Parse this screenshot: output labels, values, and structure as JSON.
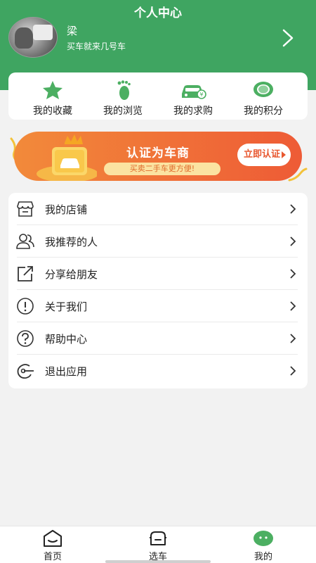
{
  "header": {
    "title": "个人中心",
    "user_name": "梁",
    "user_subtitle": "买车就来几号车"
  },
  "quick_actions": [
    {
      "label": "我的收藏",
      "icon": "star-icon"
    },
    {
      "label": "我的浏览",
      "icon": "footprint-icon"
    },
    {
      "label": "我的求购",
      "icon": "car-yen-icon"
    },
    {
      "label": "我的积分",
      "icon": "points-icon"
    }
  ],
  "banner": {
    "title": "认证为车商",
    "subtitle": "买卖二手车更方便!",
    "button_label": "立即认证"
  },
  "menu": [
    {
      "label": "我的店铺",
      "icon": "store-icon"
    },
    {
      "label": "我推荐的人",
      "icon": "users-icon"
    },
    {
      "label": "分享给朋友",
      "icon": "share-icon"
    },
    {
      "label": "关于我们",
      "icon": "info-icon"
    },
    {
      "label": "帮助中心",
      "icon": "help-icon"
    },
    {
      "label": "退出应用",
      "icon": "exit-icon"
    }
  ],
  "tabs": [
    {
      "label": "首页",
      "icon": "home-icon"
    },
    {
      "label": "选车",
      "icon": "car-select-icon"
    },
    {
      "label": "我的",
      "icon": "profile-icon",
      "active": true
    }
  ],
  "colors": {
    "primary_green": "#3fa561",
    "banner_orange": "#ee5b36",
    "banner_gold": "#fbe3a1"
  }
}
